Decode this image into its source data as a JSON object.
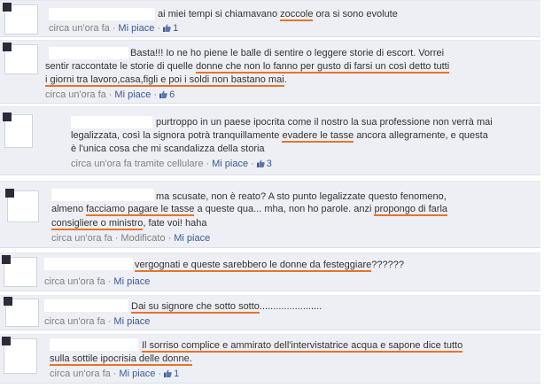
{
  "comments": [
    {
      "lines": [
        {
          "pre": "ai miei tempi si chiamavano ",
          "hl": "zoccole",
          "post": " ora si sono evolute"
        }
      ],
      "time": "circa un'ora fa",
      "like": "Mi piace",
      "likes": "1"
    },
    {
      "lines": [
        {
          "pre": "Basta!!! Io ne ho piene le balle di sentire o leggere storie di escort. Vorrei",
          "hl": "",
          "post": ""
        },
        {
          "pre": "sentir raccontate le storie di quelle ",
          "hl": "donne che non lo fanno per gusto di farsi un così detto tutti",
          "post": ""
        },
        {
          "pre": "",
          "hl": "i giorni tra lavoro,casa,figli e poi i soldi non bastano mai",
          "post": "."
        }
      ],
      "time": "circa un'ora fa",
      "like": "Mi piace",
      "likes": "6"
    },
    {
      "lines": [
        {
          "pre": "purtroppo in un paese ipocrita come il nostro la sua professione non verrà mai",
          "hl": "",
          "post": ""
        },
        {
          "pre": "legalizzata, così la signora potrà tranquillamente ",
          "hl": "evadere le tasse",
          "post": " ancora allegramente, e questa"
        },
        {
          "pre": "è l'unica cosa che mi scandalizza della storia",
          "hl": "",
          "post": ""
        }
      ],
      "time": "circa un'ora fa tramite cellulare",
      "like": "Mi piace",
      "likes": "3"
    },
    {
      "lines": [
        {
          "pre": "ma scusate, non è reato? A sto punto legalizzate questo fenomeno,",
          "hl": "",
          "post": ""
        },
        {
          "pre": "almeno ",
          "hl": "facciamo pagare le tasse",
          "post": " a queste qua... mha, non ho parole. anzi ",
          "hl2": "propongo di farla"
        },
        {
          "pre": "",
          "hl": "consigliere o ministro",
          "post": ", fate voi! haha"
        }
      ],
      "time": "circa un'ora fa",
      "modified": "Modificato",
      "like": "Mi piace"
    },
    {
      "lines": [
        {
          "pre": "",
          "hl": "vergognati e queste sarebbero le donne da festeggiare",
          "post": "??????"
        }
      ],
      "time": "circa un'ora fa",
      "like": "Mi piace"
    },
    {
      "lines": [
        {
          "pre": "",
          "hl": "Dai su signore che sotto sotto",
          "post": "......................."
        }
      ],
      "time": "circa un'ora fa",
      "like": "Mi piace"
    },
    {
      "lines": [
        {
          "pre": "",
          "hl": "Il sorriso complice e ammirato dell'intervistatrice acqua e sapone dice tutto",
          "post": ""
        },
        {
          "pre": "",
          "hl": "sulla sottile ipocrisia delle donne.",
          "post": ""
        }
      ],
      "time": "circa un'ora fa",
      "like": "Mi piace",
      "likes": "1"
    }
  ],
  "colors": {
    "background": "#edeff4",
    "link": "#3b5998",
    "meta": "#808080",
    "underline": "#e8732a"
  },
  "icons": {
    "like": "thumbs-up-icon"
  }
}
